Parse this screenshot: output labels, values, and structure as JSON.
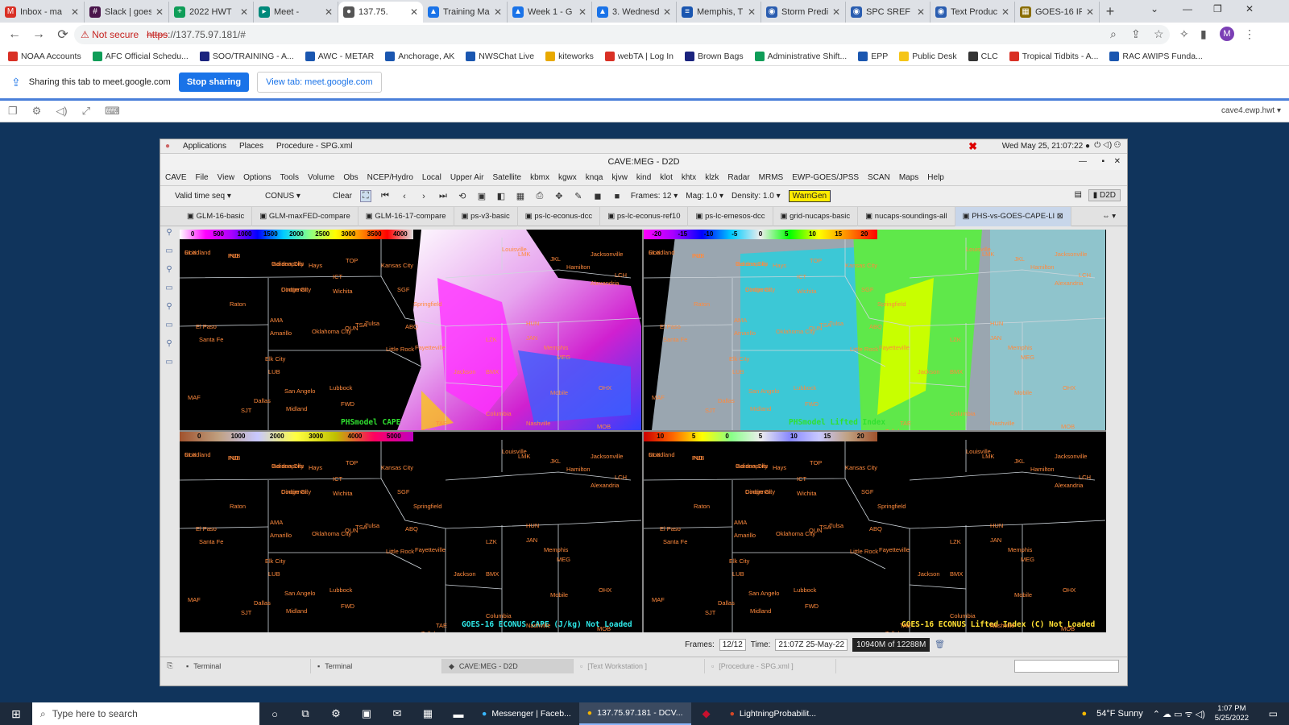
{
  "browser": {
    "tabs": [
      {
        "label": "Inbox - ma",
        "icon": "gmail-icon",
        "color": "#d93025",
        "glyph": "M"
      },
      {
        "label": "Slack | goes",
        "icon": "slack-icon",
        "color": "#4a154b",
        "glyph": "#"
      },
      {
        "label": "2022 HWT",
        "icon": "sheets-icon",
        "color": "#0f9d58",
        "glyph": "+"
      },
      {
        "label": "Meet -",
        "icon": "meet-icon",
        "color": "#00897b",
        "glyph": "▸"
      },
      {
        "label": "137.75.",
        "icon": "globe-icon",
        "color": "#555555",
        "glyph": "●",
        "active": true
      },
      {
        "label": "Training Ma",
        "icon": "drive-icon",
        "color": "#1a73e8",
        "glyph": "▲"
      },
      {
        "label": "Week 1 - G",
        "icon": "drive-icon",
        "color": "#1a73e8",
        "glyph": "▲"
      },
      {
        "label": "3. Wednesd",
        "icon": "drive-icon",
        "color": "#1a73e8",
        "glyph": "▲"
      },
      {
        "label": "Memphis, T",
        "icon": "doc-icon",
        "color": "#1a56b0",
        "glyph": "≡"
      },
      {
        "label": "Storm Predi",
        "icon": "spc-icon",
        "color": "#2a5db0",
        "glyph": "◉"
      },
      {
        "label": "SPC SREF S",
        "icon": "spc-icon",
        "color": "#2a5db0",
        "glyph": "◉"
      },
      {
        "label": "Text Produc",
        "icon": "nws-icon",
        "color": "#2a5db0",
        "glyph": "◉"
      },
      {
        "label": "GOES-16 IR",
        "icon": "noaa-icon",
        "color": "#8a6d00",
        "glyph": "▦"
      }
    ],
    "new_tab": "+",
    "omnibox": {
      "security": "Not secure",
      "scheme": "https",
      "url_rest": "://137.75.97.181/#"
    },
    "bookmarks": [
      {
        "label": "NOAA Accounts",
        "color": "#d93025"
      },
      {
        "label": "AFC Official Schedu...",
        "color": "#0f9d58"
      },
      {
        "label": "SOO/TRAINING - A...",
        "color": "#1a237e"
      },
      {
        "label": "AWC - METAR",
        "color": "#1a56b0"
      },
      {
        "label": "Anchorage, AK",
        "color": "#1a56b0"
      },
      {
        "label": "NWSChat Live",
        "color": "#1a56b0"
      },
      {
        "label": "kiteworks",
        "color": "#e8a900"
      },
      {
        "label": "webTA | Log In",
        "color": "#d93025"
      },
      {
        "label": "Brown Bags",
        "color": "#1a237e"
      },
      {
        "label": "Administrative Shift...",
        "color": "#0f9d58"
      },
      {
        "label": "EPP",
        "color": "#1a56b0"
      },
      {
        "label": "Public Desk",
        "color": "#f5c518"
      },
      {
        "label": "CLC",
        "color": "#333333"
      },
      {
        "label": "Tropical Tidbits - A...",
        "color": "#d93025"
      },
      {
        "label": "RAC AWIPS Funda...",
        "color": "#1a56b0"
      }
    ],
    "sharing": {
      "text": "Sharing this tab to meet.google.com",
      "stop": "Stop sharing",
      "view": "View tab: meet.google.com"
    }
  },
  "dcv": {
    "hostname": "cave4.ewp.hwt ▾"
  },
  "cave": {
    "gnome_menu": [
      "Applications",
      "Places",
      "Procedure - SPG.xml"
    ],
    "clock": "Wed May 25, 21:07:22 ●",
    "title": "CAVE:MEG - D2D",
    "menus": [
      "CAVE",
      "File",
      "View",
      "Options",
      "Tools",
      "Volume",
      "Obs",
      "NCEP/Hydro",
      "Local",
      "Upper Air",
      "Satellite",
      "kbmx",
      "kgwx",
      "knqa",
      "kjvw",
      "kind",
      "klot",
      "khtx",
      "klzk",
      "Radar",
      "MRMS",
      "EWP-GOES/JPSS",
      "SCAN",
      "Maps",
      "Help"
    ],
    "toolbar": {
      "time_mode": "Valid time seq",
      "scale": "CONUS",
      "clear": "Clear",
      "frames": "Frames: 12",
      "mag": "Mag: 1.0",
      "density": "Density: 1.0",
      "warngen": "WarnGen",
      "d2d": "D2D"
    },
    "procedure_tabs": [
      "GLM-16-basic",
      "GLM-maxFED-compare",
      "GLM-16-17-compare",
      "ps-v3-basic",
      "ps-lc-econus-dcc",
      "ps-lc-econus-ref10",
      "ps-lc-emesos-dcc",
      "grid-nucaps-basic",
      "nucaps-soundings-all",
      "PHS-vs-GOES-CAPE-LI"
    ],
    "panes": [
      {
        "id": "top-left",
        "colorbar": [
          "0",
          "500",
          "1000",
          "1500",
          "2000",
          "2500",
          "3000",
          "3500",
          "4000"
        ],
        "legend": "PHSmodel CAPE",
        "legend_color": "#30e030"
      },
      {
        "id": "top-right",
        "colorbar": [
          "-20",
          "-15",
          "-10",
          "-5",
          "0",
          "5",
          "10",
          "15",
          "20"
        ],
        "legend": "PHSmodel Lifted Index",
        "legend_color": "#30e030"
      },
      {
        "id": "bottom-left",
        "colorbar": [
          "0",
          "1000",
          "2000",
          "3000",
          "4000",
          "5000"
        ],
        "legend": "GOES-16 ECONUS CAPE (J/kg)  Not Loaded",
        "legend_color": "#2ee8e8"
      },
      {
        "id": "bottom-right",
        "colorbar": [
          "10",
          "5",
          "0",
          "5",
          "10",
          "15",
          "20"
        ],
        "legend": "GOES-16 ECONUS Lifted Index (C)  Not Loaded",
        "legend_color": "#ffe033"
      }
    ],
    "cities": [
      "Goodland",
      "PUB",
      "Garden City",
      "Dodge City",
      "Hays",
      "ICT",
      "Wichita",
      "TOP",
      "Kansas City",
      "SGF",
      "Springfield",
      "Raton",
      "AMA",
      "Amarillo",
      "Tulsa",
      "TSA",
      "OUN",
      "Oklahoma City",
      "Elk City",
      "LUB",
      "Lubbock",
      "FWD",
      "Dallas",
      "Midland",
      "San Angelo",
      "SJT",
      "MAF",
      "El Paso",
      "Santa Fe",
      "ABQ",
      "Fayetteville",
      "Little Rock",
      "LZK",
      "Jackson",
      "JAN",
      "BMX",
      "HUN",
      "MEG",
      "Memphis",
      "OHX",
      "Nashville",
      "Columbia",
      "Tallahassee",
      "TAE",
      "Mobile",
      "MOB",
      "LCH",
      "Alexandria",
      "Hamilton",
      "Jacksonville",
      "Louisville",
      "LMK",
      "JKL",
      "RLX",
      "IND",
      "Indianapolis",
      "Cincinnati"
    ],
    "status": {
      "frames_label": "Frames:",
      "frames": "12/12",
      "time_label": "Time:",
      "time": "21:07Z 25-May-22",
      "memory": "10940M of 12288M"
    },
    "panel": [
      {
        "label": "Terminal",
        "state": "normal"
      },
      {
        "label": "Terminal",
        "state": "normal"
      },
      {
        "label": "CAVE:MEG - D2D",
        "state": "on"
      },
      {
        "label": "[Text Workstation ]",
        "state": "dim"
      },
      {
        "label": "[Procedure - SPG.xml ]",
        "state": "dim"
      }
    ]
  },
  "taskbar": {
    "search": "Type here to search",
    "apps": [
      {
        "label": "Messenger | Faceb...",
        "icon": "edge-icon",
        "on": false
      },
      {
        "label": "137.75.97.181 - DCV...",
        "icon": "chrome-icon",
        "on": true
      },
      {
        "label": "LightningProbabilit...",
        "icon": "powerpoint-icon",
        "on": false
      }
    ],
    "weather": "54°F  Sunny",
    "time": "1:07 PM",
    "date": "5/25/2022"
  }
}
